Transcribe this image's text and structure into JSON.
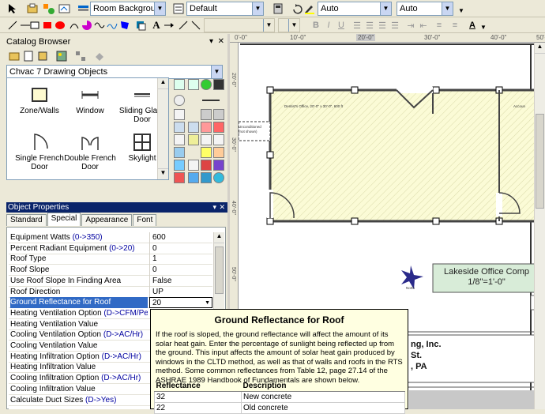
{
  "toolbar1": {
    "layer_combo": "Room Background",
    "style_combo": "Default",
    "auto1": "Auto",
    "auto2": "Auto"
  },
  "toolbar2": {
    "ruler_labels": [
      "0'-0\"",
      "10'-0\"",
      "20'-0\"",
      "30'-0\"",
      "40'-0\"",
      "50'-0\""
    ]
  },
  "catalog": {
    "title": "Catalog Browser",
    "selector": "Chvac 7 Drawing Objects",
    "items": [
      {
        "label": "Zone/Walls"
      },
      {
        "label": "Window"
      },
      {
        "label": "Sliding Glass Door"
      },
      {
        "label": "Single French Door"
      },
      {
        "label": "Double French Door"
      },
      {
        "label": "Skylight"
      }
    ]
  },
  "object_properties": {
    "title": "Object Properties",
    "tabs": [
      "Standard",
      "Special",
      "Appearance",
      "Font"
    ],
    "active_tab": "Special",
    "rows": [
      {
        "key": "Equipment Watts",
        "hint": "(0->350)",
        "value": "600"
      },
      {
        "key": "Percent Radiant Equipment",
        "hint": "(0->20)",
        "value": "0"
      },
      {
        "key": "Roof Type",
        "hint": "",
        "value": "1"
      },
      {
        "key": "Roof Slope",
        "hint": "",
        "value": "0"
      },
      {
        "key": "Use Roof Slope In Finding Area",
        "hint": "",
        "value": "False"
      },
      {
        "key": "Roof Direction",
        "hint": "",
        "value": "UP"
      },
      {
        "key": "Ground Reflectance for Roof",
        "hint": "",
        "value": "20"
      },
      {
        "key": "Heating Ventilation Option",
        "hint": "(D->CFM/Person)",
        "value": ""
      },
      {
        "key": "Heating Ventilation Value",
        "hint": "",
        "value": ""
      },
      {
        "key": "Cooling Ventilation Option",
        "hint": "(D->AC/Hr)",
        "value": ""
      },
      {
        "key": "Cooling Ventilation Value",
        "hint": "",
        "value": ""
      },
      {
        "key": "Heating Infiltration Option",
        "hint": "(D->AC/Hr)",
        "value": ""
      },
      {
        "key": "Heating Infiltration Value",
        "hint": "",
        "value": ""
      },
      {
        "key": "Cooling Infiltration Option",
        "hint": "(D->AC/Hr)",
        "value": ""
      },
      {
        "key": "Cooling Infiltration Value",
        "hint": "",
        "value": ""
      },
      {
        "key": "Calculate Duct Sizes",
        "hint": "(D->Yes)",
        "value": ""
      }
    ]
  },
  "drawing": {
    "room_label": "Dentist's Office, 20'-0\" x 30'-0\", 600 ft",
    "room2_label": "Accoun",
    "side_label_1": "Unconditioned",
    "side_label_2": "(not shown)",
    "north_label": "North",
    "title_block": {
      "line1": "Lakeside Office Comp",
      "line2": "1/8\"=1'-0\""
    },
    "company_lines": [
      "ng, Inc.",
      "St.",
      ", PA"
    ],
    "vertical_ruler": [
      "20'-0\"",
      "30'-0\"",
      "40'-0\"",
      "50'-0\""
    ]
  },
  "tooltip": {
    "title": "Ground Reflectance for Roof",
    "text": "If the roof is sloped, the ground reflectance will affect the amount of its solar heat gain. Enter the percentage of sunlight being reflected up from the ground. This input affects the amount of solar heat gain produced by windows in the CLTD method, as well as that of walls and roofs in the RTS method. Some common reflectances from Table 12, page 27.14 of the ASHRAE 1989 Handbook of Fundamentals are shown below.",
    "col1": "Reflectance",
    "col2": "Description",
    "rows": [
      {
        "r": "32",
        "d": "New concrete"
      },
      {
        "r": "22",
        "d": "Old concrete"
      }
    ]
  },
  "colors": {
    "selection": "#316ac5",
    "room_fill": "#fbfbd6",
    "title_block": "#d8ecd8"
  }
}
